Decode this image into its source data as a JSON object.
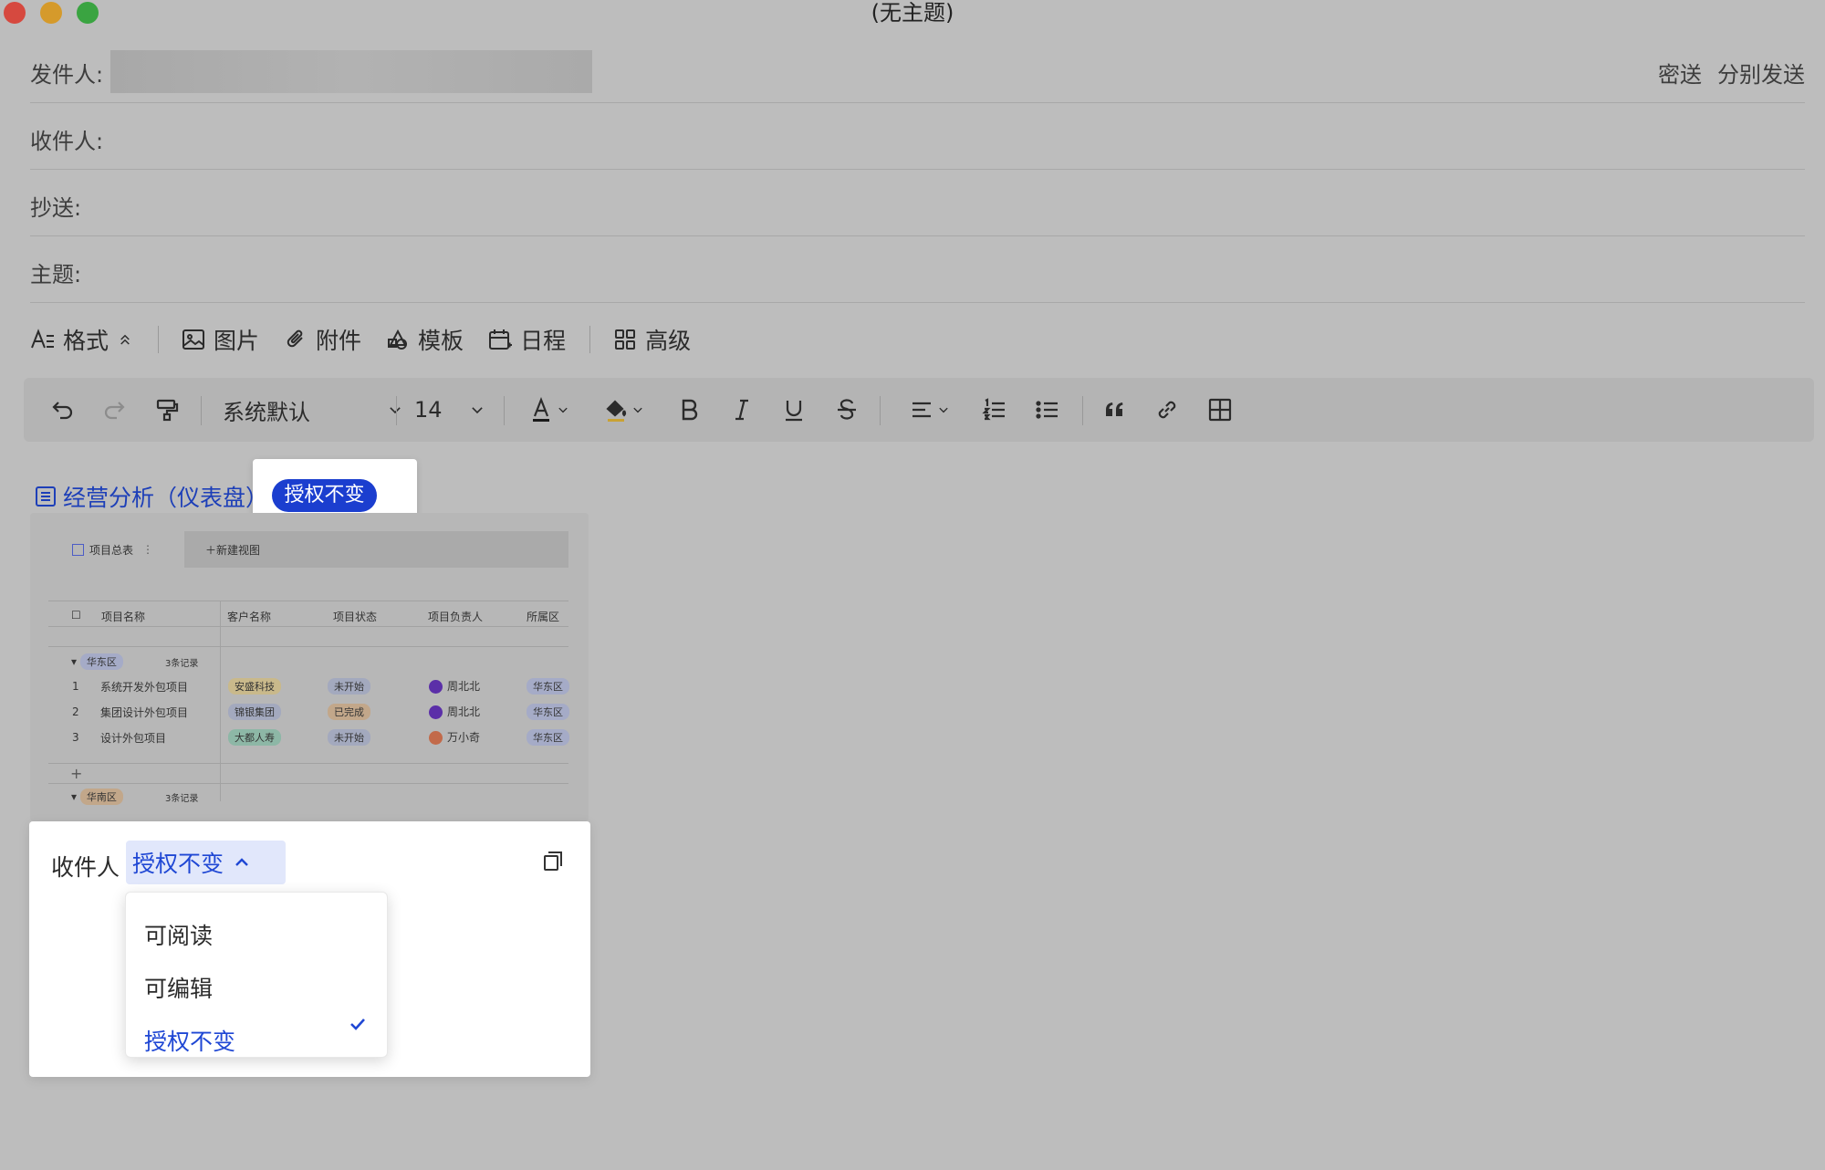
{
  "window": {
    "title": "(无主题)"
  },
  "header": {
    "from_label": "发件人:",
    "to_label": "收件人:",
    "cc_label": "抄送:",
    "subject_label": "主题:",
    "bcc_label": "密送",
    "separate_send_label": "分别发送"
  },
  "toolbar": {
    "format_label": "格式",
    "image_label": "图片",
    "attachment_label": "附件",
    "template_label": "模板",
    "schedule_label": "日程",
    "advanced_label": "高级"
  },
  "format_bar": {
    "font_family": "系统默认",
    "font_size": "14"
  },
  "doc_link": {
    "title": "经营分析（仪表盘）",
    "permission_badge": "授权不变"
  },
  "preview": {
    "tab_label": "项目总表",
    "new_view_label": "新建视图",
    "columns": [
      "项目名称",
      "客户名称",
      "项目状态",
      "项目负责人",
      "所属区"
    ],
    "group": {
      "name": "华东区",
      "count_label": "3条记录"
    },
    "group2": {
      "name": "华南区",
      "count_label": "3条记录"
    },
    "rows": [
      {
        "no": "1",
        "name": "系统开发外包项目",
        "client": "安盛科技",
        "status": "未开始",
        "owner": "周北北",
        "region": "华东区"
      },
      {
        "no": "2",
        "name": "集团设计外包项目",
        "client": "锦银集团",
        "status": "已完成",
        "owner": "周北北",
        "region": "华东区"
      },
      {
        "no": "3",
        "name": "设计外包项目",
        "client": "大都人寿",
        "status": "未开始",
        "owner": "万小奇",
        "region": "华东区"
      }
    ],
    "add_label": "+"
  },
  "share": {
    "recipient_label": "收件人",
    "permission_current": "授权不变",
    "options": [
      "可阅读",
      "可编辑",
      "授权不变"
    ]
  }
}
